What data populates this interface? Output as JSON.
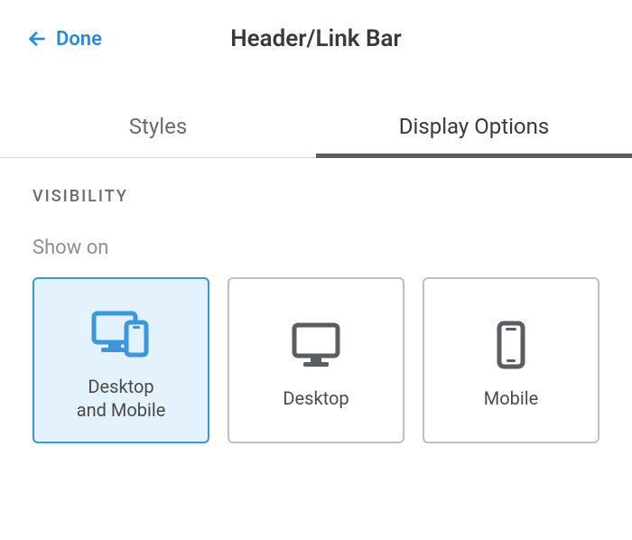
{
  "header": {
    "back_label": "Done",
    "title": "Header/Link Bar"
  },
  "tabs": [
    {
      "label": "Styles",
      "active": false
    },
    {
      "label": "Display Options",
      "active": true
    }
  ],
  "visibility": {
    "section_label": "VISIBILITY",
    "show_on_label": "Show on",
    "options": [
      {
        "label": "Desktop\nand Mobile",
        "icon": "desktop-mobile-icon",
        "selected": true
      },
      {
        "label": "Desktop",
        "icon": "desktop-icon",
        "selected": false
      },
      {
        "label": "Mobile",
        "icon": "mobile-icon",
        "selected": false
      }
    ]
  },
  "colors": {
    "accent": "#2b8ad6",
    "selected_bg": "#e3f2fc",
    "icon_gray": "#5a5e63"
  }
}
